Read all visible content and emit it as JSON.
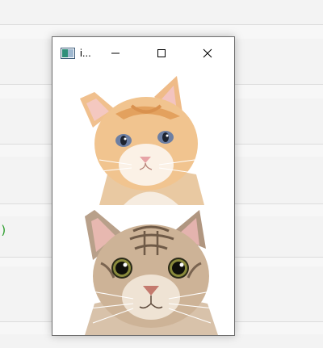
{
  "window": {
    "title": "i...",
    "icon": "opencv-window-icon",
    "controls": [
      "minimize-icon",
      "maximize-icon",
      "close-icon"
    ]
  },
  "images": {
    "top": "orange-kitten-photo",
    "bottom": "tabby-cat-photo"
  },
  "background": {
    "code_fragment": ")"
  },
  "colors": {
    "code_green": "#2e9e2e",
    "window_border": "#6e6e6e"
  }
}
